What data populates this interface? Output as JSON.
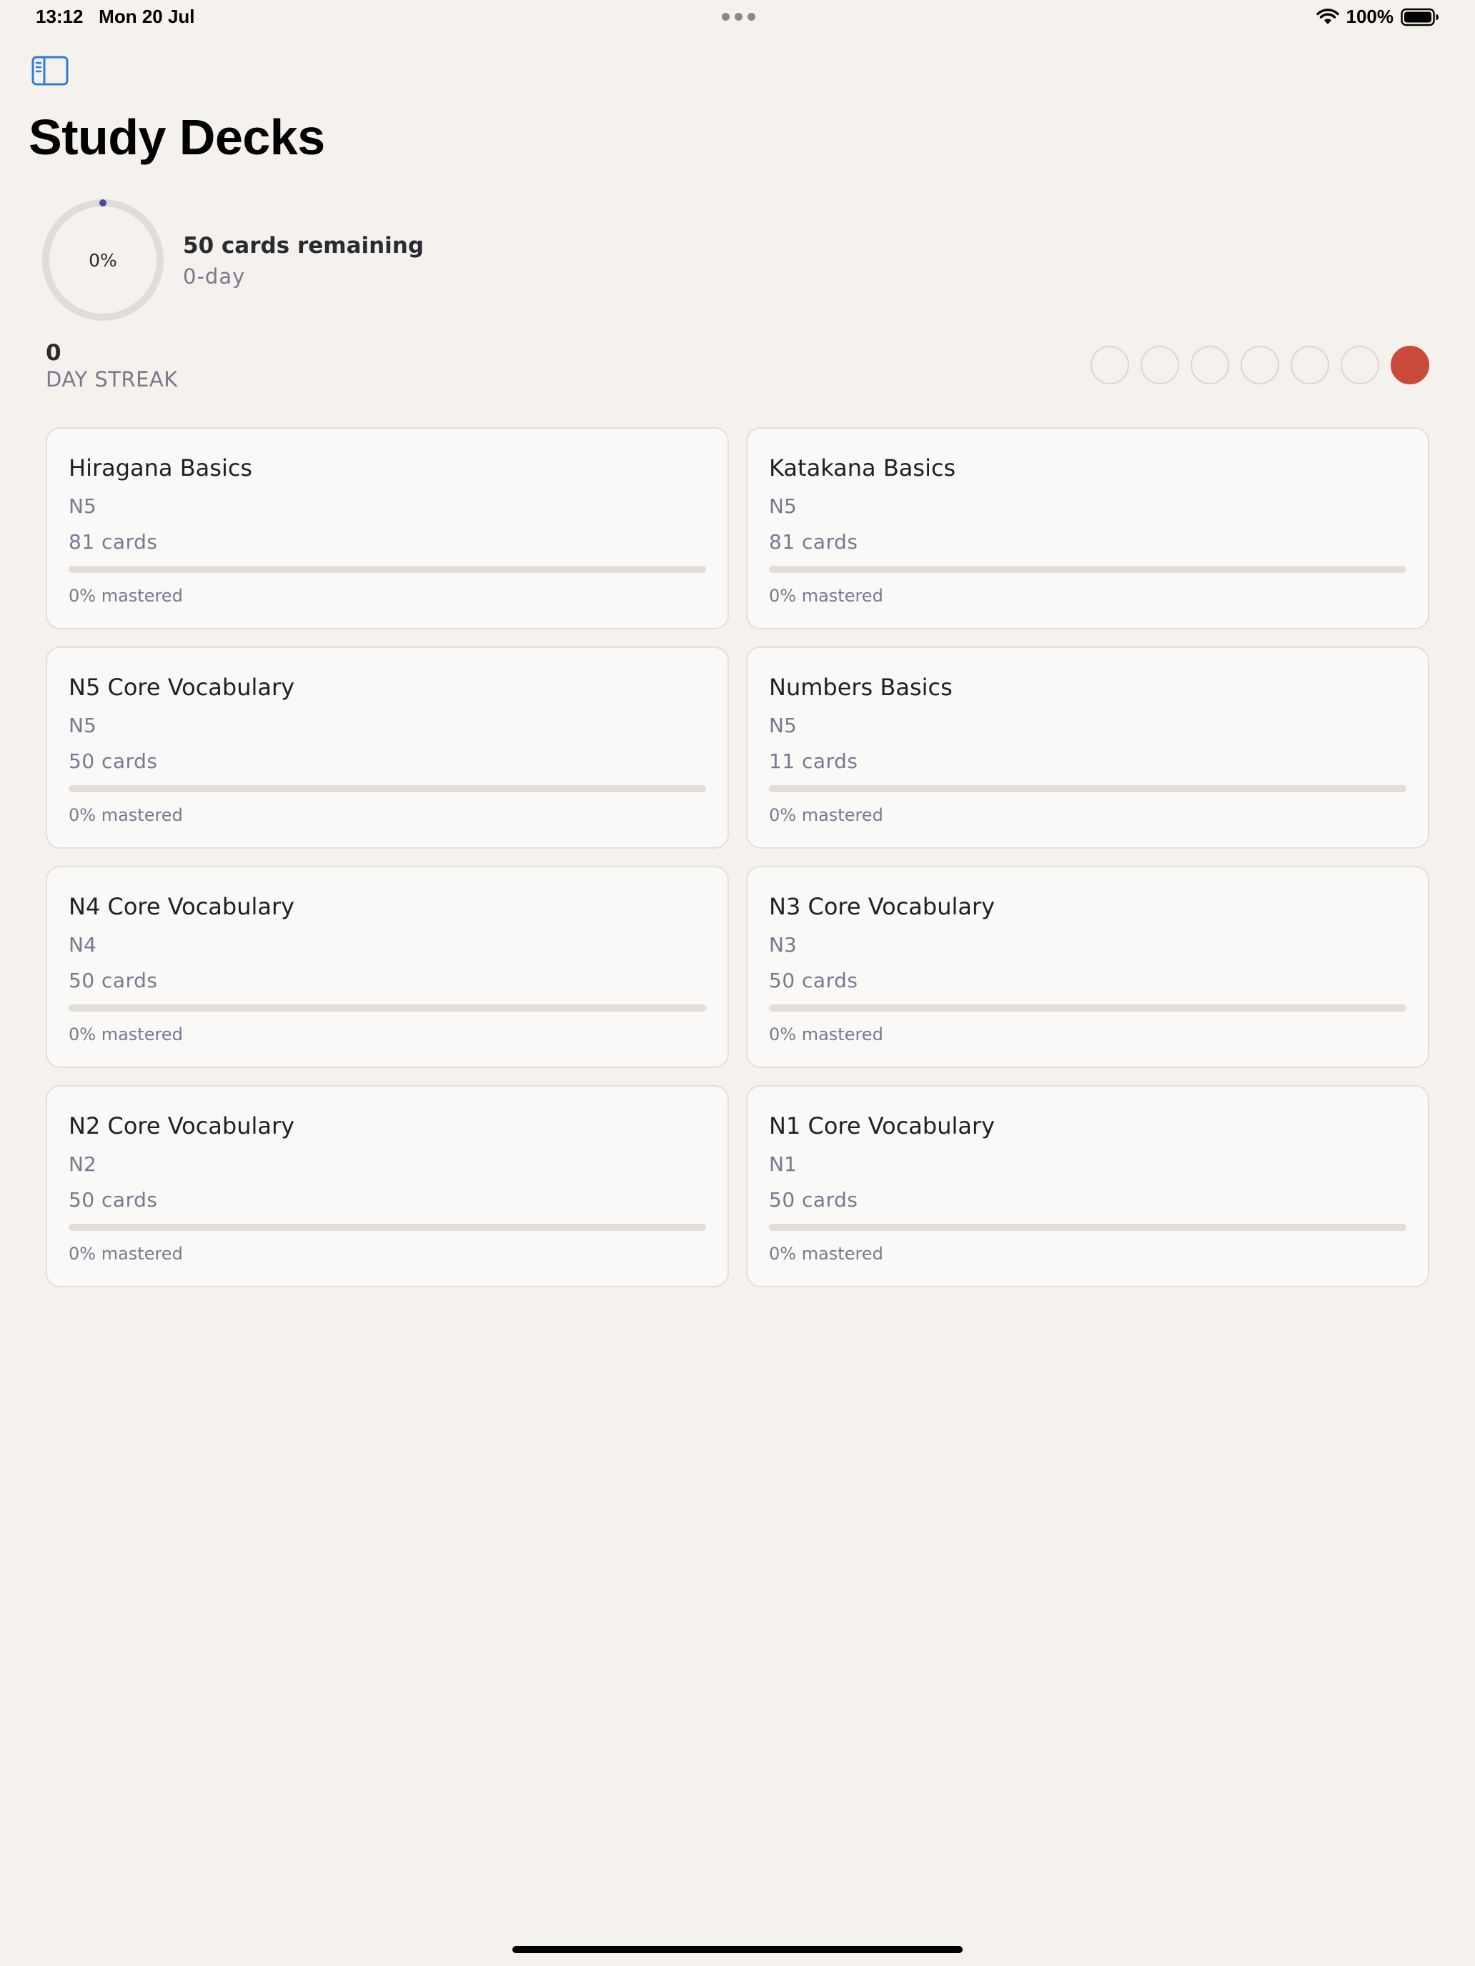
{
  "status_bar": {
    "time": "13:12",
    "date": "Mon 20 Jul",
    "battery": "100%"
  },
  "page": {
    "title": "Study Decks"
  },
  "daily_progress": {
    "percent_label": "0%",
    "percent_value": 0,
    "cards_remaining": "50 cards remaining",
    "day_text": "0-day",
    "accent_color": "#4a4a9a"
  },
  "streak": {
    "count": "0",
    "label": "DAY STREAK",
    "week": [
      false,
      false,
      false,
      false,
      false,
      false,
      true
    ],
    "active_color": "#c94a3a"
  },
  "decks": [
    {
      "title": "Hiragana Basics",
      "level": "N5",
      "count": "81 cards",
      "mastered_label": "0% mastered",
      "mastered": 0
    },
    {
      "title": "Katakana Basics",
      "level": "N5",
      "count": "81 cards",
      "mastered_label": "0% mastered",
      "mastered": 0
    },
    {
      "title": "N5 Core Vocabulary",
      "level": "N5",
      "count": "50 cards",
      "mastered_label": "0% mastered",
      "mastered": 0
    },
    {
      "title": "Numbers Basics",
      "level": "N5",
      "count": "11 cards",
      "mastered_label": "0% mastered",
      "mastered": 0
    },
    {
      "title": "N4 Core Vocabulary",
      "level": "N4",
      "count": "50 cards",
      "mastered_label": "0% mastered",
      "mastered": 0
    },
    {
      "title": "N3 Core Vocabulary",
      "level": "N3",
      "count": "50 cards",
      "mastered_label": "0% mastered",
      "mastered": 0
    },
    {
      "title": "N2 Core Vocabulary",
      "level": "N2",
      "count": "50 cards",
      "mastered_label": "0% mastered",
      "mastered": 0
    },
    {
      "title": "N1 Core Vocabulary",
      "level": "N1",
      "count": "50 cards",
      "mastered_label": "0% mastered",
      "mastered": 0
    }
  ],
  "icons": {
    "sidebar_toggle": "sidebar-icon",
    "wifi": "wifi-icon",
    "battery": "battery-icon"
  }
}
